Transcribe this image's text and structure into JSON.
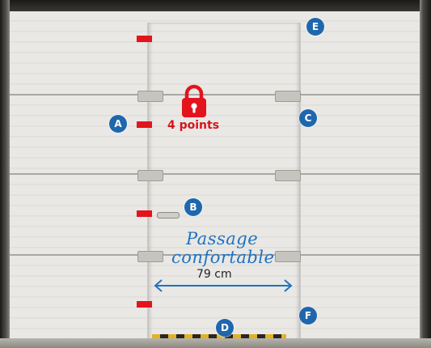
{
  "lock": {
    "label": "4 points",
    "icon": "padlock-icon"
  },
  "markers": [
    "A",
    "B",
    "C",
    "D",
    "E",
    "F"
  ],
  "passage": {
    "line1": "Passage",
    "line2": "confortable",
    "width": "79 cm"
  },
  "colors": {
    "accent_red": "#e3141c",
    "badge_blue": "#1f67ad",
    "script_blue": "#1f73c2"
  }
}
